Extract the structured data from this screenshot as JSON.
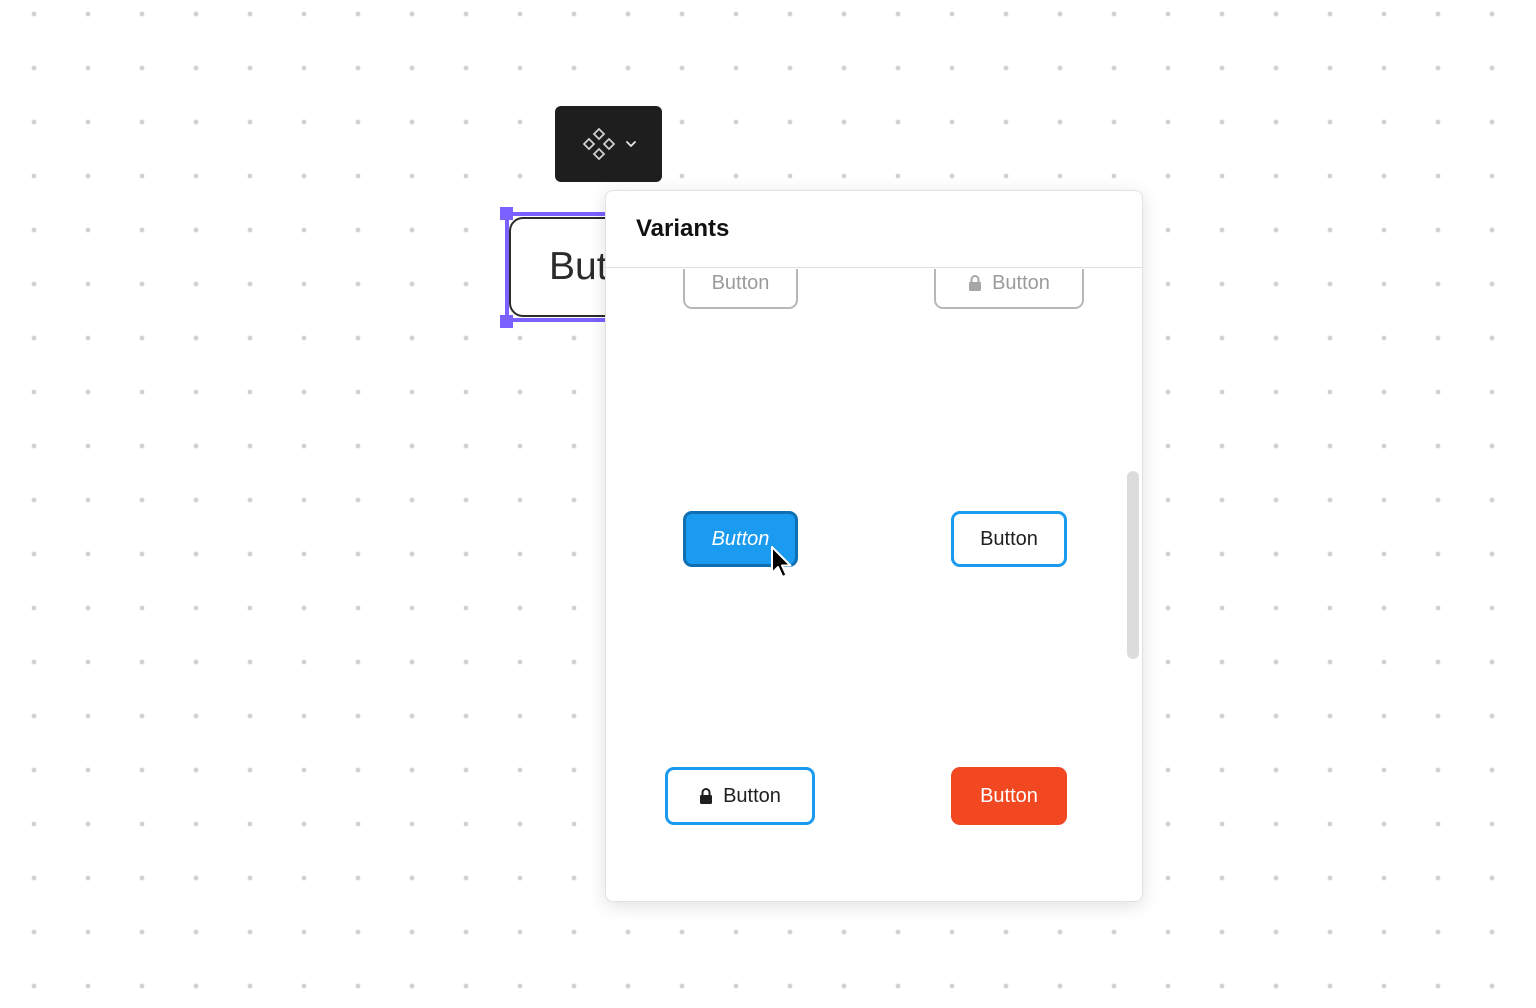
{
  "canvas": {
    "selected_button_label": "Button"
  },
  "toolbar": {
    "component_icon": "component-icon",
    "dropdown_icon": "chevron-down-icon"
  },
  "variants_panel": {
    "title": "Variants",
    "items": [
      {
        "label": "Button",
        "state": "disabled",
        "icon": null
      },
      {
        "label": "Button",
        "state": "disabled-locked",
        "icon": "lock-icon"
      },
      {
        "label": "Button",
        "state": "primary-hover",
        "icon": null
      },
      {
        "label": "Button",
        "state": "outline",
        "icon": null
      },
      {
        "label": "Button",
        "state": "outline-locked",
        "icon": "lock-icon"
      },
      {
        "label": "Button",
        "state": "danger",
        "icon": null
      }
    ]
  },
  "colors": {
    "selection": "#7b61ff",
    "primary": "#1a9bf0",
    "primary_border": "#0f6fb3",
    "danger": "#f24822",
    "disabled_text": "#9b9b9b",
    "toolbar_bg": "#1e1e1e"
  }
}
